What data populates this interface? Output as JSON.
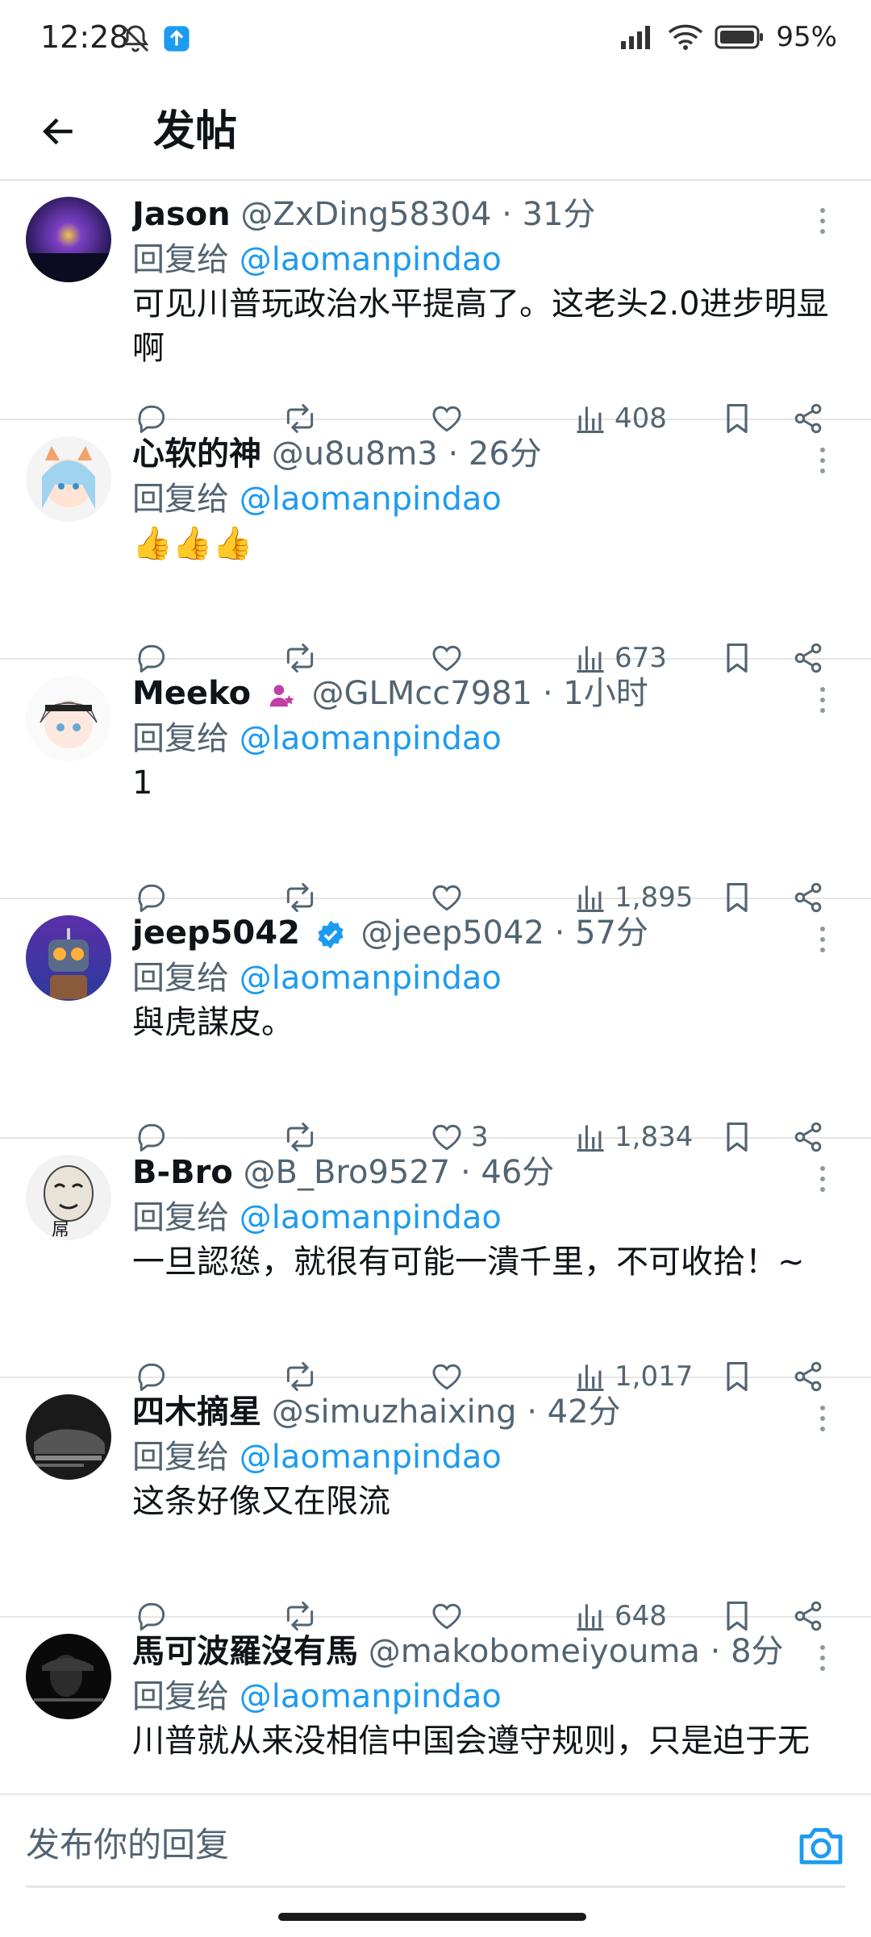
{
  "status_bar": {
    "time": "12:28",
    "battery": "95%"
  },
  "header": {
    "title": "发帖"
  },
  "reply_prefix": "回复给",
  "posts": [
    {
      "name": "Jason",
      "handle": "@ZxDing58304",
      "time": "31分",
      "reply_to": "@laomanpindao",
      "text": "可见川普玩政治水平提高了。这老头2.0进步明显啊",
      "likes": "",
      "views": "408"
    },
    {
      "name": "心软的神",
      "handle": "@u8u8m3",
      "time": "26分",
      "reply_to": "@laomanpindao",
      "text": "👍👍👍",
      "likes": "",
      "views": "673"
    },
    {
      "name": "Meeko",
      "handle": "@GLMcc7981",
      "time": "1小时",
      "reply_to": "@laomanpindao",
      "text": "1",
      "likes": "",
      "views": "1,895"
    },
    {
      "name": "jeep5042",
      "handle": "@jeep5042",
      "time": "57分",
      "reply_to": "@laomanpindao",
      "text": "與虎謀皮。",
      "likes": "3",
      "views": "1,834"
    },
    {
      "name": "B-Bro",
      "handle": "@B_Bro9527",
      "time": "46分",
      "reply_to": "@laomanpindao",
      "text": "一旦認慫，就很有可能一潰千里，不可收拾！~",
      "likes": "",
      "views": "1,017"
    },
    {
      "name": "四木摘星",
      "handle": "@simuzhaixing",
      "time": "42分",
      "reply_to": "@laomanpindao",
      "text": "这条好像又在限流",
      "likes": "",
      "views": "648"
    },
    {
      "name": "馬可波羅沒有馬",
      "handle": "@makobomeiyouma",
      "time": "8分",
      "reply_to": "@laomanpindao",
      "text": "川普就从来没相信中国会遵守规则，只是迫于无",
      "likes": "",
      "views": ""
    }
  ],
  "reply_bar": {
    "placeholder": "发布你的回复"
  },
  "colors": {
    "accent": "#1d9bf0",
    "secondary_text": "#536471",
    "primary_text": "#0f1419"
  }
}
